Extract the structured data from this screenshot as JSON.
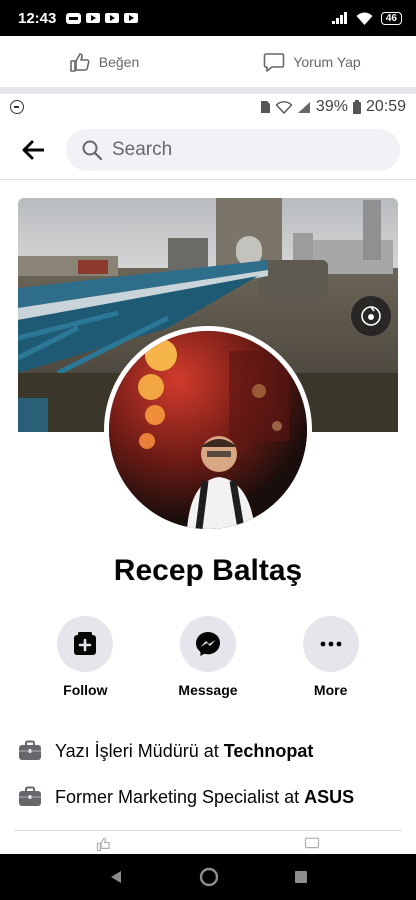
{
  "statusbar": {
    "time": "12:43",
    "battery": "46"
  },
  "outer_actions": {
    "like_label": "Beğen",
    "comment_label": "Yorum Yap"
  },
  "inner_status": {
    "battery_percent": "39%",
    "time": "20:59"
  },
  "header": {
    "search_placeholder": "Search"
  },
  "profile": {
    "name": "Recep Baltaş"
  },
  "actions": [
    {
      "label": "Follow",
      "icon": "add-friend-icon"
    },
    {
      "label": "Message",
      "icon": "messenger-icon"
    },
    {
      "label": "More",
      "icon": "more-icon"
    }
  ],
  "info": [
    {
      "prefix": "Yazı İşleri Müdürü at ",
      "org": "Technopat",
      "icon": "briefcase-icon"
    },
    {
      "prefix": "Former Marketing Specialist at ",
      "org": "ASUS",
      "icon": "briefcase-icon"
    }
  ],
  "colors": {
    "accent": "#1877f2",
    "secondary_bg": "#e4e6eb",
    "search_bg": "#f0f2f5",
    "text_muted": "#65676b"
  }
}
